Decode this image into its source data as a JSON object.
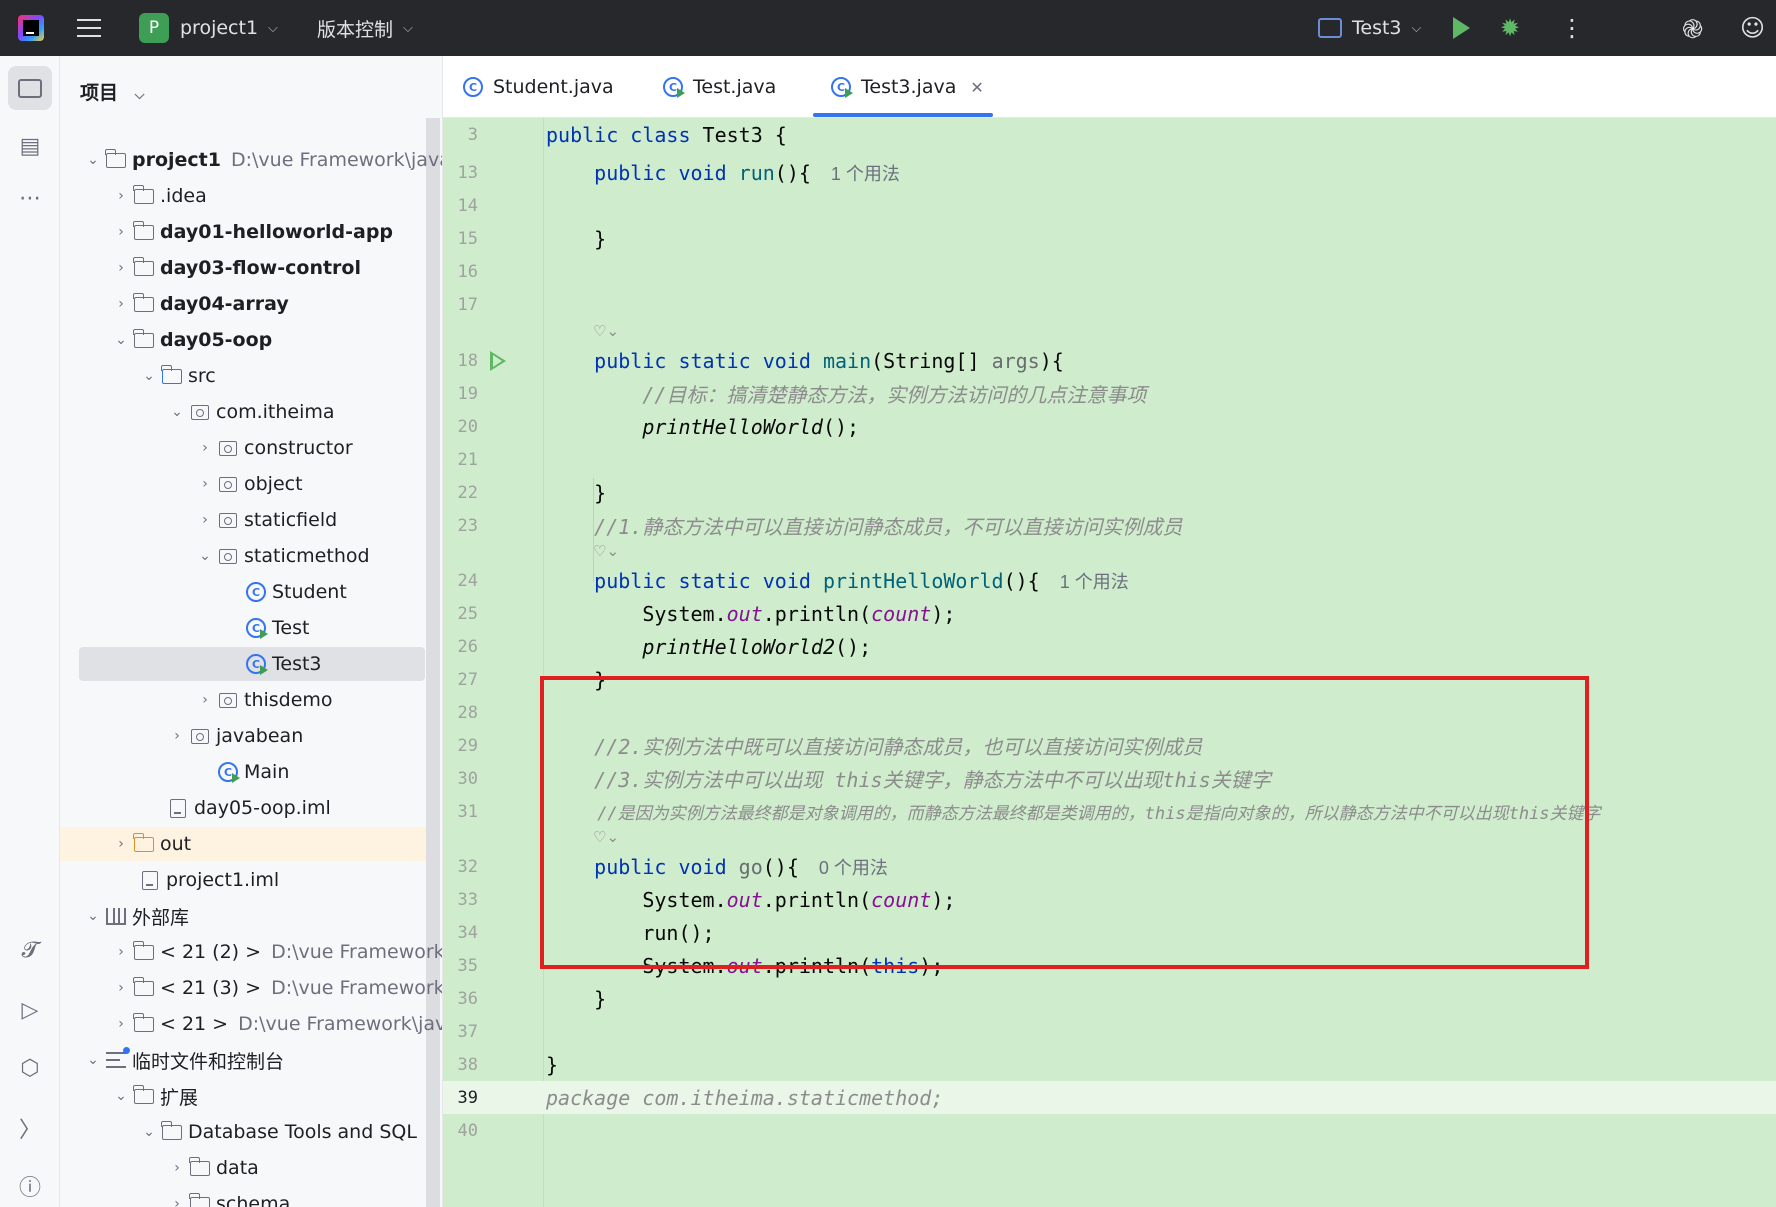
{
  "topbar": {
    "project_badge": "P",
    "project_name": "project1",
    "vcs_label": "版本控制",
    "run_config": "Test3"
  },
  "panel": {
    "title": "项目",
    "tree": [
      {
        "label": "project1",
        "path": "D:\\vue  Framework\\java\\c",
        "icon": "module-folder-icon",
        "bold": true
      },
      {
        "label": ".idea",
        "icon": "folder-icon"
      },
      {
        "label": "day01-helloworld-app",
        "icon": "module-folder-icon",
        "bold": true
      },
      {
        "label": "day03-flow-control",
        "icon": "module-folder-icon",
        "bold": true
      },
      {
        "label": "day04-array",
        "icon": "module-folder-icon",
        "bold": true
      },
      {
        "label": "day05-oop",
        "icon": "module-folder-icon",
        "bold": true
      },
      {
        "label": "src",
        "icon": "source-folder-icon"
      },
      {
        "label": "com.itheima",
        "icon": "package-icon"
      },
      {
        "label": "constructor",
        "icon": "package-icon"
      },
      {
        "label": "object",
        "icon": "package-icon"
      },
      {
        "label": "staticfield",
        "icon": "package-icon"
      },
      {
        "label": "staticmethod",
        "icon": "package-icon"
      },
      {
        "label": "Student",
        "icon": "class-icon"
      },
      {
        "label": "Test",
        "icon": "runnable-class-icon"
      },
      {
        "label": "Test3",
        "icon": "runnable-class-icon"
      },
      {
        "label": "thisdemo",
        "icon": "package-icon"
      },
      {
        "label": "javabean",
        "icon": "package-icon"
      },
      {
        "label": "Main",
        "icon": "runnable-class-icon"
      },
      {
        "label": "day05-oop.iml",
        "icon": "file-icon"
      },
      {
        "label": "out",
        "icon": "excluded-folder-icon"
      },
      {
        "label": "project1.iml",
        "icon": "file-icon"
      },
      {
        "label": "外部库",
        "icon": "library-icon"
      },
      {
        "label": "< 21 (2) >",
        "path": "D:\\vue  Framework\\ja",
        "icon": "sdk-folder-icon"
      },
      {
        "label": "< 21 (3) >",
        "path": "D:\\vue  Framework\\ja",
        "icon": "sdk-folder-icon"
      },
      {
        "label": "< 21 >",
        "path": "D:\\vue  Framework\\java\\",
        "icon": "sdk-folder-icon"
      },
      {
        "label": "临时文件和控制台",
        "icon": "scratches-icon"
      },
      {
        "label": "扩展",
        "icon": "folder-icon"
      },
      {
        "label": "Database Tools and SQL",
        "icon": "folder-icon"
      },
      {
        "label": "data",
        "icon": "folder-icon"
      },
      {
        "label": "schema",
        "icon": "folder-icon"
      }
    ]
  },
  "tabs": [
    {
      "label": "Student.java",
      "icon": "class-icon"
    },
    {
      "label": "Test.java",
      "icon": "runnable-class-icon"
    },
    {
      "label": "Test3.java",
      "icon": "runnable-class-icon",
      "active": true
    }
  ],
  "editor": {
    "usage_1": "1 个用法",
    "usage_0": "0 个用法",
    "lines": {
      "n3": "3",
      "n13": "13",
      "n14": "14",
      "n15": "15",
      "n16": "16",
      "n17": "17",
      "n18": "18",
      "n19": "19",
      "n20": "20",
      "n21": "21",
      "n22": "22",
      "n23": "23",
      "n24": "24",
      "n25": "25",
      "n26": "26",
      "n27": "27",
      "n28": "28",
      "n29": "29",
      "n30": "30",
      "n31": "31",
      "n32": "32",
      "n33": "33",
      "n34": "34",
      "n35": "35",
      "n36": "36",
      "n37": "37",
      "n38": "38",
      "n39": "39",
      "n40": "40"
    },
    "comments": {
      "c19": "//目标：搞清楚静态方法，实例方法访问的几点注意事项",
      "c23": "//1.静态方法中可以直接访问静态成员，不可以直接访问实例成员",
      "c29": "//2.实例方法中既可以直接访问静态成员，也可以直接访问实例成员",
      "c30": "//3.实例方法中可以出现 this关键字，静态方法中不可以出现this关键字",
      "c31": "//是因为实例方法最终都是对象调用的，而静态方法最终都是类调用的，this是指向对象的，所以静态方法中不可以出现this关键字"
    },
    "package_line": "package com.itheima.staticmethod;"
  }
}
